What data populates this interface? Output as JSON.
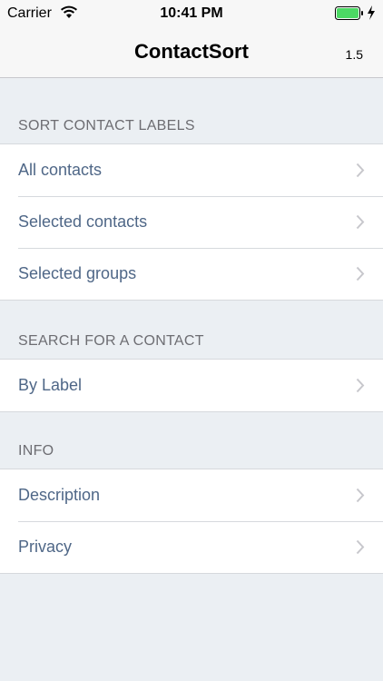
{
  "status_bar": {
    "carrier": "Carrier",
    "time": "10:41 PM",
    "icons": [
      "wifi-icon",
      "battery-icon",
      "charging-bolt-icon"
    ],
    "battery_color": "#4cd964"
  },
  "nav": {
    "title": "ContactSort",
    "version": "1.5"
  },
  "sections": {
    "sort": {
      "header": "SORT CONTACT LABELS",
      "items": [
        "All contacts",
        "Selected contacts",
        "Selected groups"
      ]
    },
    "search": {
      "header": "SEARCH FOR A CONTACT",
      "items": [
        "By Label"
      ]
    },
    "info": {
      "header": "INFO",
      "items": [
        "Description",
        "Privacy"
      ]
    }
  },
  "colors": {
    "background": "#ebeff3",
    "row_text": "#4f6787",
    "header_text": "#6d6d72",
    "chevron": "#c7c7cc"
  }
}
